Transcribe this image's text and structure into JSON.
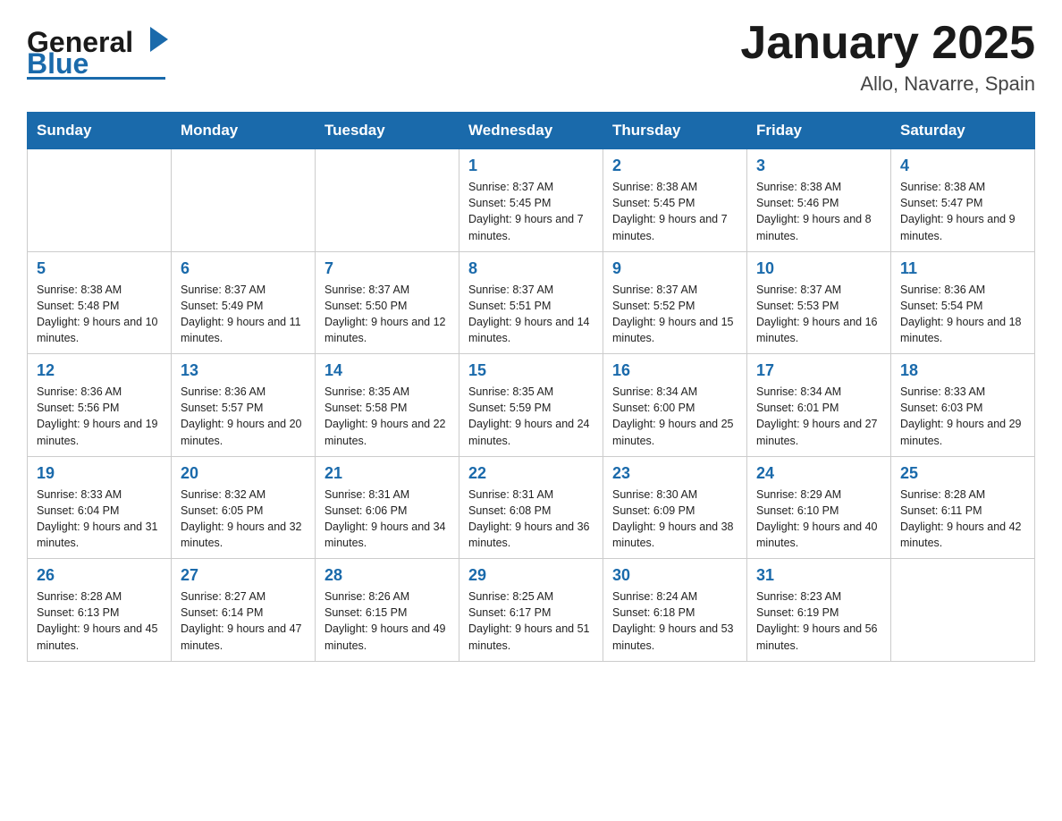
{
  "header": {
    "logo": {
      "general": "General",
      "blue": "Blue",
      "tagline": ""
    },
    "title": "January 2025",
    "subtitle": "Allo, Navarre, Spain"
  },
  "days_of_week": [
    "Sunday",
    "Monday",
    "Tuesday",
    "Wednesday",
    "Thursday",
    "Friday",
    "Saturday"
  ],
  "weeks": [
    [
      {
        "day": "",
        "info": ""
      },
      {
        "day": "",
        "info": ""
      },
      {
        "day": "",
        "info": ""
      },
      {
        "day": "1",
        "info": "Sunrise: 8:37 AM\nSunset: 5:45 PM\nDaylight: 9 hours and 7 minutes."
      },
      {
        "day": "2",
        "info": "Sunrise: 8:38 AM\nSunset: 5:45 PM\nDaylight: 9 hours and 7 minutes."
      },
      {
        "day": "3",
        "info": "Sunrise: 8:38 AM\nSunset: 5:46 PM\nDaylight: 9 hours and 8 minutes."
      },
      {
        "day": "4",
        "info": "Sunrise: 8:38 AM\nSunset: 5:47 PM\nDaylight: 9 hours and 9 minutes."
      }
    ],
    [
      {
        "day": "5",
        "info": "Sunrise: 8:38 AM\nSunset: 5:48 PM\nDaylight: 9 hours and 10 minutes."
      },
      {
        "day": "6",
        "info": "Sunrise: 8:37 AM\nSunset: 5:49 PM\nDaylight: 9 hours and 11 minutes."
      },
      {
        "day": "7",
        "info": "Sunrise: 8:37 AM\nSunset: 5:50 PM\nDaylight: 9 hours and 12 minutes."
      },
      {
        "day": "8",
        "info": "Sunrise: 8:37 AM\nSunset: 5:51 PM\nDaylight: 9 hours and 14 minutes."
      },
      {
        "day": "9",
        "info": "Sunrise: 8:37 AM\nSunset: 5:52 PM\nDaylight: 9 hours and 15 minutes."
      },
      {
        "day": "10",
        "info": "Sunrise: 8:37 AM\nSunset: 5:53 PM\nDaylight: 9 hours and 16 minutes."
      },
      {
        "day": "11",
        "info": "Sunrise: 8:36 AM\nSunset: 5:54 PM\nDaylight: 9 hours and 18 minutes."
      }
    ],
    [
      {
        "day": "12",
        "info": "Sunrise: 8:36 AM\nSunset: 5:56 PM\nDaylight: 9 hours and 19 minutes."
      },
      {
        "day": "13",
        "info": "Sunrise: 8:36 AM\nSunset: 5:57 PM\nDaylight: 9 hours and 20 minutes."
      },
      {
        "day": "14",
        "info": "Sunrise: 8:35 AM\nSunset: 5:58 PM\nDaylight: 9 hours and 22 minutes."
      },
      {
        "day": "15",
        "info": "Sunrise: 8:35 AM\nSunset: 5:59 PM\nDaylight: 9 hours and 24 minutes."
      },
      {
        "day": "16",
        "info": "Sunrise: 8:34 AM\nSunset: 6:00 PM\nDaylight: 9 hours and 25 minutes."
      },
      {
        "day": "17",
        "info": "Sunrise: 8:34 AM\nSunset: 6:01 PM\nDaylight: 9 hours and 27 minutes."
      },
      {
        "day": "18",
        "info": "Sunrise: 8:33 AM\nSunset: 6:03 PM\nDaylight: 9 hours and 29 minutes."
      }
    ],
    [
      {
        "day": "19",
        "info": "Sunrise: 8:33 AM\nSunset: 6:04 PM\nDaylight: 9 hours and 31 minutes."
      },
      {
        "day": "20",
        "info": "Sunrise: 8:32 AM\nSunset: 6:05 PM\nDaylight: 9 hours and 32 minutes."
      },
      {
        "day": "21",
        "info": "Sunrise: 8:31 AM\nSunset: 6:06 PM\nDaylight: 9 hours and 34 minutes."
      },
      {
        "day": "22",
        "info": "Sunrise: 8:31 AM\nSunset: 6:08 PM\nDaylight: 9 hours and 36 minutes."
      },
      {
        "day": "23",
        "info": "Sunrise: 8:30 AM\nSunset: 6:09 PM\nDaylight: 9 hours and 38 minutes."
      },
      {
        "day": "24",
        "info": "Sunrise: 8:29 AM\nSunset: 6:10 PM\nDaylight: 9 hours and 40 minutes."
      },
      {
        "day": "25",
        "info": "Sunrise: 8:28 AM\nSunset: 6:11 PM\nDaylight: 9 hours and 42 minutes."
      }
    ],
    [
      {
        "day": "26",
        "info": "Sunrise: 8:28 AM\nSunset: 6:13 PM\nDaylight: 9 hours and 45 minutes."
      },
      {
        "day": "27",
        "info": "Sunrise: 8:27 AM\nSunset: 6:14 PM\nDaylight: 9 hours and 47 minutes."
      },
      {
        "day": "28",
        "info": "Sunrise: 8:26 AM\nSunset: 6:15 PM\nDaylight: 9 hours and 49 minutes."
      },
      {
        "day": "29",
        "info": "Sunrise: 8:25 AM\nSunset: 6:17 PM\nDaylight: 9 hours and 51 minutes."
      },
      {
        "day": "30",
        "info": "Sunrise: 8:24 AM\nSunset: 6:18 PM\nDaylight: 9 hours and 53 minutes."
      },
      {
        "day": "31",
        "info": "Sunrise: 8:23 AM\nSunset: 6:19 PM\nDaylight: 9 hours and 56 minutes."
      },
      {
        "day": "",
        "info": ""
      }
    ]
  ]
}
